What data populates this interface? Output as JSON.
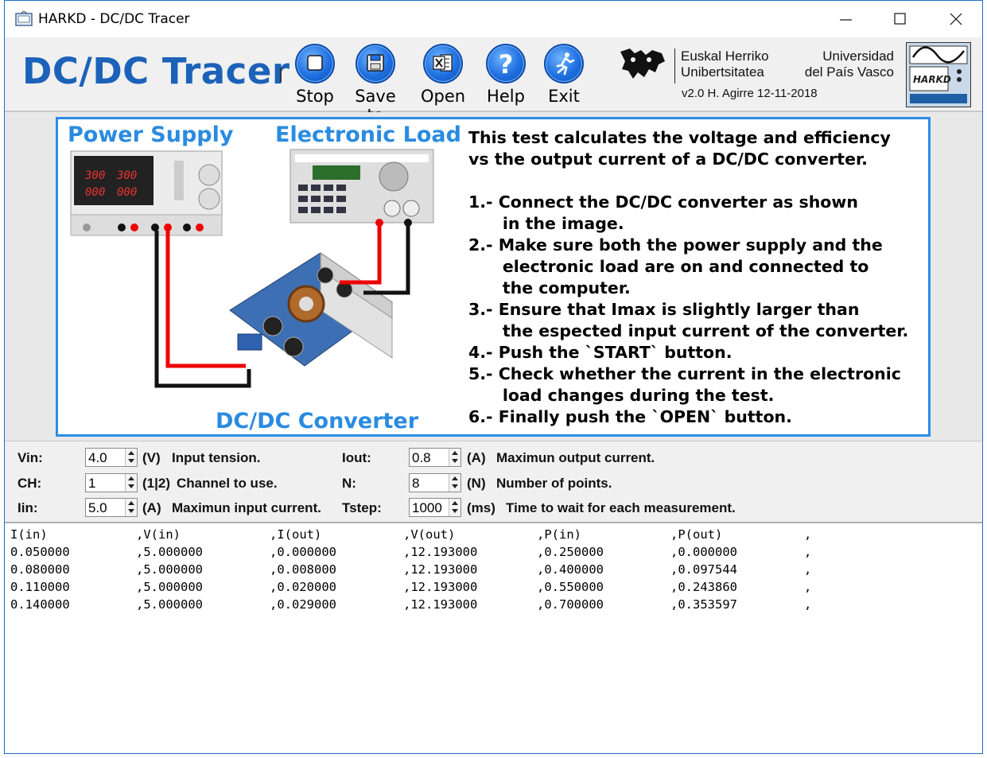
{
  "window": {
    "title": "HARKD - DC/DC Tracer"
  },
  "header": {
    "app_name": "DC/DC Tracer",
    "buttons": [
      {
        "label": "Stop",
        "icon": "stop-icon"
      },
      {
        "label": "Save to",
        "icon": "save-icon"
      },
      {
        "label": "Open",
        "icon": "excel-icon"
      },
      {
        "label": "Help",
        "icon": "help-icon"
      },
      {
        "label": "Exit",
        "icon": "exit-icon"
      }
    ],
    "university": {
      "name_basque_1": "Euskal Herriko",
      "name_basque_2": "Unibertsitatea",
      "name_spanish_1": "Universidad",
      "name_spanish_2": "del País Vasco"
    },
    "version": "v2.0 H. Agirre 12-11-2018",
    "harkd_label": "HARKD"
  },
  "figure": {
    "power_supply_caption": "Power Supply",
    "electronic_load_caption": "Electronic Load",
    "converter_caption": "DC/DC Converter",
    "psu_display_1": "300",
    "psu_display_2": "300",
    "psu_display_3": "000",
    "psu_display_4": "000",
    "instructions": [
      "This test calculates the voltage and efficiency",
      "vs the output current of a DC/DC converter.",
      "",
      "1.- Connect the DC/DC converter as shown",
      "      in the image.",
      "2.- Make sure both the power supply and the",
      "      electronic load are on and connected to",
      "      the computer.",
      "3.- Ensure that Imax is slightly larger than",
      "      the espected input current of the converter.",
      "4.- Push the `START` button.",
      "5.- Check whether the current in the electronic",
      "      load changes during the test.",
      "6.- Finally push the `OPEN` button."
    ]
  },
  "params": {
    "vin": {
      "label": "Vin:",
      "value": "4.0",
      "unit": "(V)",
      "desc": "Input tension."
    },
    "ch": {
      "label": "CH:",
      "value": "1",
      "unit": "(1|2)",
      "desc": "Channel to use."
    },
    "iin": {
      "label": "Iin:",
      "value": "5.0",
      "unit": "(A)",
      "desc": "Maximun input current."
    },
    "iout": {
      "label": "Iout:",
      "value": "0.8",
      "unit": "(A)",
      "desc": "Maximun output current."
    },
    "n": {
      "label": "N:",
      "value": "8",
      "unit": "(N)",
      "desc": "Number of points."
    },
    "tstep": {
      "label": "Tstep:",
      "value": "1000",
      "unit": "(ms)",
      "desc": "Time to wait for each measurement."
    }
  },
  "output": {
    "rows": [
      [
        "I(in)",
        ",V(in)",
        ",I(out)",
        ",V(out)",
        ",P(in)",
        ",P(out)",
        ","
      ],
      [
        "0.050000",
        ",5.000000",
        ",0.000000",
        ",12.193000",
        ",0.250000",
        ",0.000000",
        ","
      ],
      [
        "0.080000",
        ",5.000000",
        ",0.008000",
        ",12.193000",
        ",0.400000",
        ",0.097544",
        ","
      ],
      [
        "0.110000",
        ",5.000000",
        ",0.020000",
        ",12.193000",
        ",0.550000",
        ",0.243860",
        ","
      ],
      [
        "0.140000",
        ",5.000000",
        ",0.029000",
        ",12.193000",
        ",0.700000",
        ",0.353597",
        ","
      ]
    ]
  }
}
